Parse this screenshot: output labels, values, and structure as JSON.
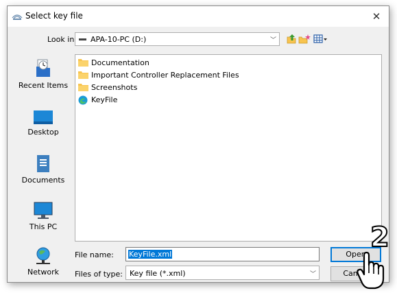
{
  "dialog": {
    "title": "Select key file",
    "close_symbol": "✕"
  },
  "lookin": {
    "label": "Look in:",
    "value": "APA-10-PC (D:)"
  },
  "places": [
    {
      "label": "Recent Items",
      "icon": "recent-items-icon"
    },
    {
      "label": "Desktop",
      "icon": "desktop-icon"
    },
    {
      "label": "Documents",
      "icon": "documents-icon"
    },
    {
      "label": "This PC",
      "icon": "this-pc-icon"
    },
    {
      "label": "Network",
      "icon": "network-icon"
    }
  ],
  "files": [
    {
      "name": "Documentation",
      "icon": "folder-icon"
    },
    {
      "name": "Important Controller Replacement Files",
      "icon": "folder-icon"
    },
    {
      "name": "Screenshots",
      "icon": "folder-icon"
    },
    {
      "name": "KeyFile",
      "icon": "edge-file-icon"
    }
  ],
  "filename": {
    "label": "File name:",
    "value": "KeyFile.xml"
  },
  "filetype": {
    "label": "Files of type:",
    "value": "Key file (*.xml)"
  },
  "buttons": {
    "open": "Open",
    "cancel": "Cancel"
  },
  "annotation": {
    "step": "2"
  },
  "colors": {
    "accent": "#0078d7",
    "folder": "#f8c44f"
  }
}
